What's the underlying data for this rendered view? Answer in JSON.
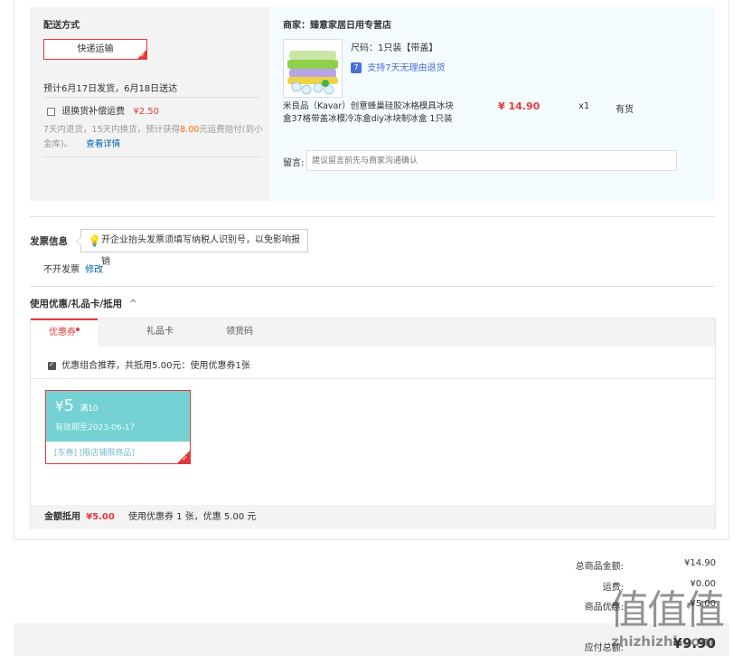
{
  "delivery": {
    "label": "配送方式",
    "method": "快递运输",
    "eta": "预计6月17日发货，6月18日送达",
    "insurance_label": "退换货补偿运费",
    "insurance_price": "¥2.50",
    "insurance_desc_prefix": "7天内退货，15天内换货，预计获得",
    "insurance_amount": "8.00",
    "insurance_desc_suffix": "元运费赔付(到小",
    "insurance_desc_line2": "金库)。",
    "details_link": "查看详情"
  },
  "shop": {
    "name_label": "商家：",
    "name": "臻意家居日用专营店",
    "spec": "尺码：1只装【带盖】",
    "refund_icon": "7",
    "refund_text": "支持7天无理由退货",
    "product_title_line1": "米良品（Kavar）创意蜂巢硅胶冰格模具冰块",
    "product_title_line2": "盒37格带盖冰模冷冻盒diy冰块制冰盒 1只装",
    "price": "¥ 14.90",
    "quantity": "x1",
    "stock": "有货",
    "remark_label": "留言:",
    "remark_placeholder": "建议留言前先与商家沟通确认"
  },
  "invoice": {
    "label": "发票信息",
    "tip": "开企业抬头发票须填写纳税人识别号，以免影响报销",
    "status": "不开发票",
    "modify_link": "修改"
  },
  "coupon": {
    "label": "使用优惠/礼品卡/抵用",
    "toggle_icon": "^",
    "tabs": [
      "优惠券",
      "礼品卡",
      "领货码"
    ],
    "recommend_text": "优惠组合推荐，共抵用5.00元：使用优惠券1张",
    "card": {
      "amount_symbol": "¥",
      "amount": "5",
      "condition": "满10",
      "expiry": "有效期至2023-06-17",
      "tags": "[东券] [限店铺限商品]"
    },
    "summary_prefix": "金额抵用",
    "summary_amount": "¥5.00",
    "summary_suffix": "使用优惠券 1 张，优惠 5.00 元"
  },
  "totals": {
    "goods_label": "总商品金额:",
    "goods_value": "¥14.90",
    "shipping_label": "运费:",
    "shipping_value": "¥0.00",
    "discount_label": "商品优惠:",
    "discount_value": "-¥5.00",
    "payable_label": "应付总额:",
    "payable_value": "¥9.90"
  },
  "watermark": {
    "text": "值值值",
    "url": "zhizhizhi.com"
  },
  "colors": {
    "accent": "#e4393c",
    "coupon": "#74d2d4",
    "link": "#005ea7",
    "orange": "#ff6600"
  }
}
